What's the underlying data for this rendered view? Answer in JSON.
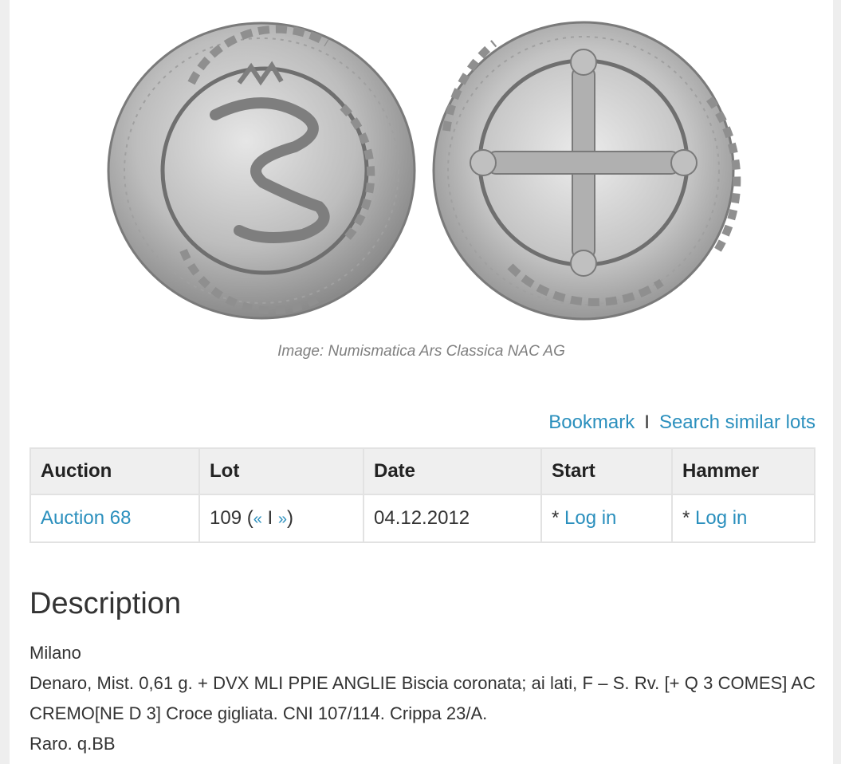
{
  "image": {
    "caption": "Image: Numismatica Ars Classica NAC AG"
  },
  "actions": {
    "bookmark": "Bookmark",
    "separator": "I",
    "search_similar": "Search similar lots"
  },
  "table": {
    "headers": [
      "Auction",
      "Lot",
      "Date",
      "Start",
      "Hammer"
    ],
    "row": {
      "auction": "Auction 68",
      "lot_number": "109 (",
      "lot_prev": "«",
      "lot_sep": "I",
      "lot_next": "»",
      "lot_close": ")",
      "date": "04.12.2012",
      "start_prefix": "* ",
      "start_login": "Log in",
      "hammer_prefix": "* ",
      "hammer_login": "Log in"
    }
  },
  "description": {
    "heading": "Description",
    "lines": [
      "Milano",
      "Denaro, Mist. 0,61 g. + DVX MLI PPIE ANGLIE Biscia coronata; ai lati, F – S. Rv. [+ Q 3 COMES] AC CREMO[NE D 3] Croce gigliata. CNI 107/114. Crippa 23/A.",
      "Raro. q.BB"
    ]
  },
  "colors": {
    "link": "#2a8fbd",
    "header_bg": "#efefef",
    "border": "#e2e2e2",
    "caption": "#808080"
  }
}
